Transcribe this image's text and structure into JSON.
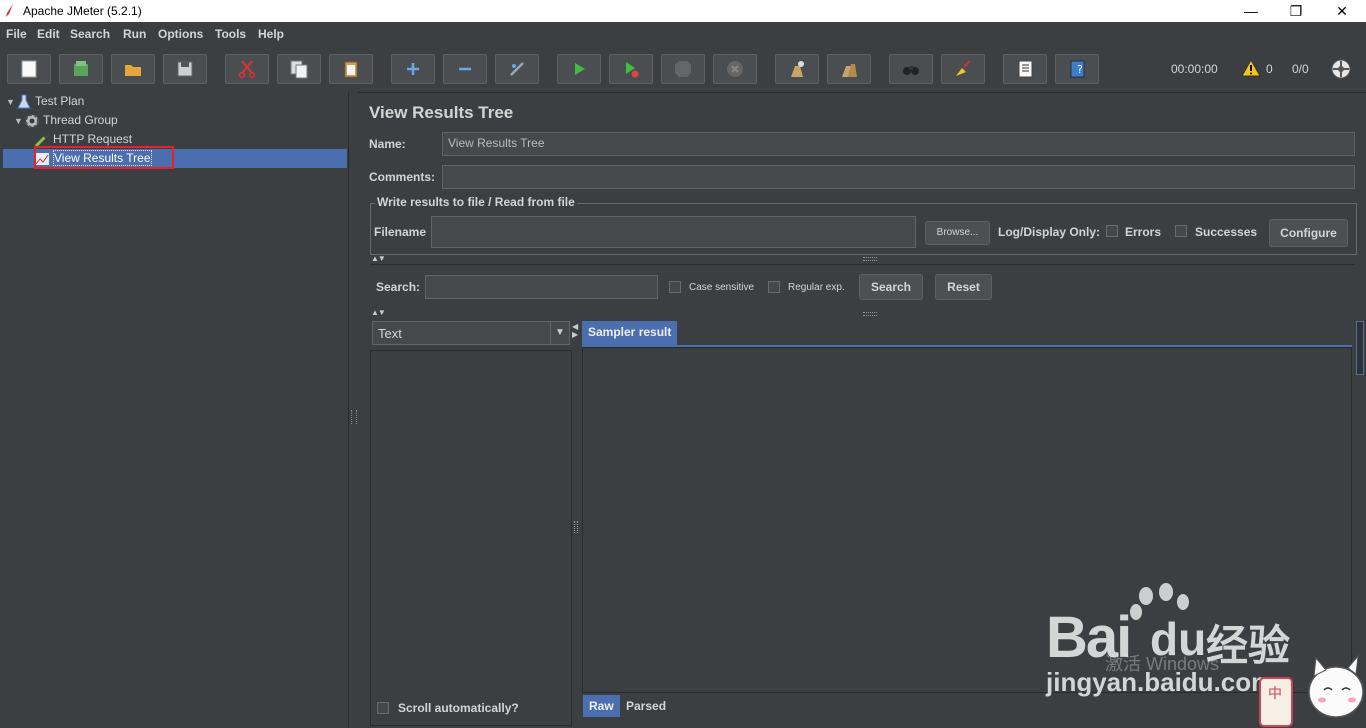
{
  "window": {
    "title": "Apache JMeter (5.2.1)",
    "minimize": "—",
    "restore": "❐",
    "close": "✕"
  },
  "menu": [
    "File",
    "Edit",
    "Search",
    "Run",
    "Options",
    "Tools",
    "Help"
  ],
  "toolbar": {
    "buttons": [
      "new-icon",
      "templates-icon",
      "open-icon",
      "save-icon",
      "cut-icon",
      "copy-icon",
      "paste-icon",
      "expand-icon",
      "collapse-icon",
      "toggle-icon",
      "start-icon",
      "start-no-pauses-icon",
      "stop-icon",
      "shutdown-icon",
      "clear-icon",
      "clear-all-icon",
      "search-icon",
      "reset-search-icon",
      "function-helper-icon",
      "help-icon"
    ],
    "timer": "00:00:00",
    "warning_count": "0",
    "threads": "0/0"
  },
  "tree": {
    "nodes": [
      {
        "label": "Test Plan",
        "icon": "flask-icon"
      },
      {
        "label": "Thread Group",
        "icon": "gear-icon"
      },
      {
        "label": "HTTP Request",
        "icon": "pipette-icon"
      },
      {
        "label": "View Results Tree",
        "icon": "chart-icon"
      }
    ],
    "selected_index": 3
  },
  "panel": {
    "title": "View Results Tree",
    "name_label": "Name:",
    "name_value": "View Results Tree",
    "comments_label": "Comments:",
    "comments_value": "",
    "file_group_title": "Write results to file / Read from file",
    "filename_label": "Filename",
    "filename_value": "",
    "browse_label": "Browse...",
    "log_display_label": "Log/Display Only:",
    "errors_label": "Errors",
    "successes_label": "Successes",
    "configure_label": "Configure",
    "search_label": "Search:",
    "search_value": "",
    "case_sensitive_label": "Case sensitive",
    "regular_exp_label": "Regular exp.",
    "search_button": "Search",
    "reset_button": "Reset",
    "renderer_value": "Text",
    "sampler_tab": "Sampler result",
    "raw_tab": "Raw",
    "parsed_tab": "Parsed",
    "scroll_auto_label": "Scroll automatically?"
  },
  "watermark": {
    "activate_line1": "激活 Windows",
    "logo_text": "Bai",
    "logo_text2": "du",
    "logo_cn": "经验",
    "url": "jingyan.baidu.com"
  }
}
